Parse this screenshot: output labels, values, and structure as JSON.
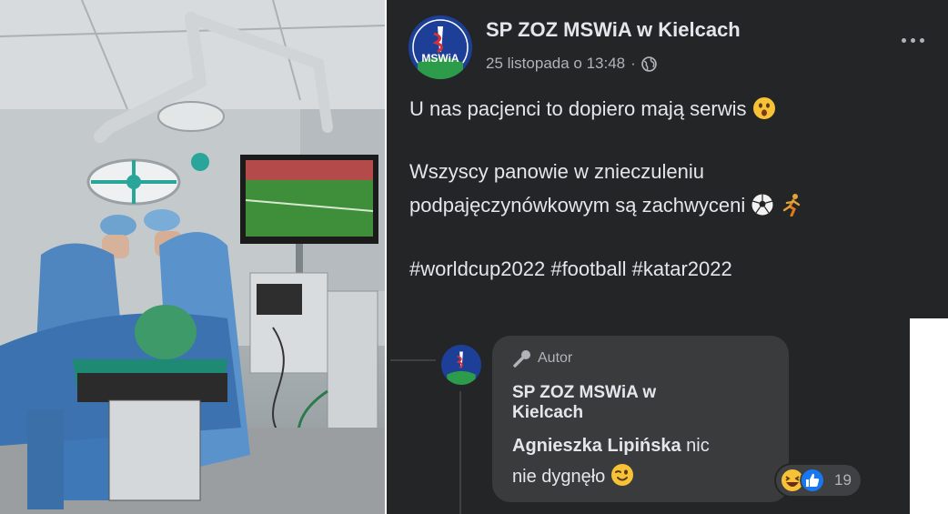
{
  "post": {
    "page_name": "SP ZOZ MSWiA w Kielcach",
    "timestamp": "25 listopada o 13:48",
    "separator": "·",
    "audience_icon": "globe-icon",
    "more_icon": "more-options-icon",
    "avatar_label": "MSWiA",
    "lines": [
      "U nas pacjenci to dopiero mają serwis",
      "Wszyscy panowie w znieczuleniu",
      "podpajęczynówkowym są zachwyceni",
      "#worldcup2022 #football #katar2022"
    ]
  },
  "comment": {
    "author_badge": "Autor",
    "author_name_line1": "SP ZOZ MSWiA w",
    "author_name_line2": "Kielcach",
    "mention": "Agnieszka Lipińska",
    "text_part1": " nic",
    "text_part2": "nie dygnęło",
    "reactions_count": "19",
    "reaction_icons": [
      "haha-icon",
      "like-icon"
    ]
  },
  "colors": {
    "panel_bg": "#242526",
    "bubble_bg": "#3a3b3c",
    "text_primary": "#e4e6eb",
    "text_secondary": "#b0b3b8",
    "like_blue": "#1877f2"
  }
}
